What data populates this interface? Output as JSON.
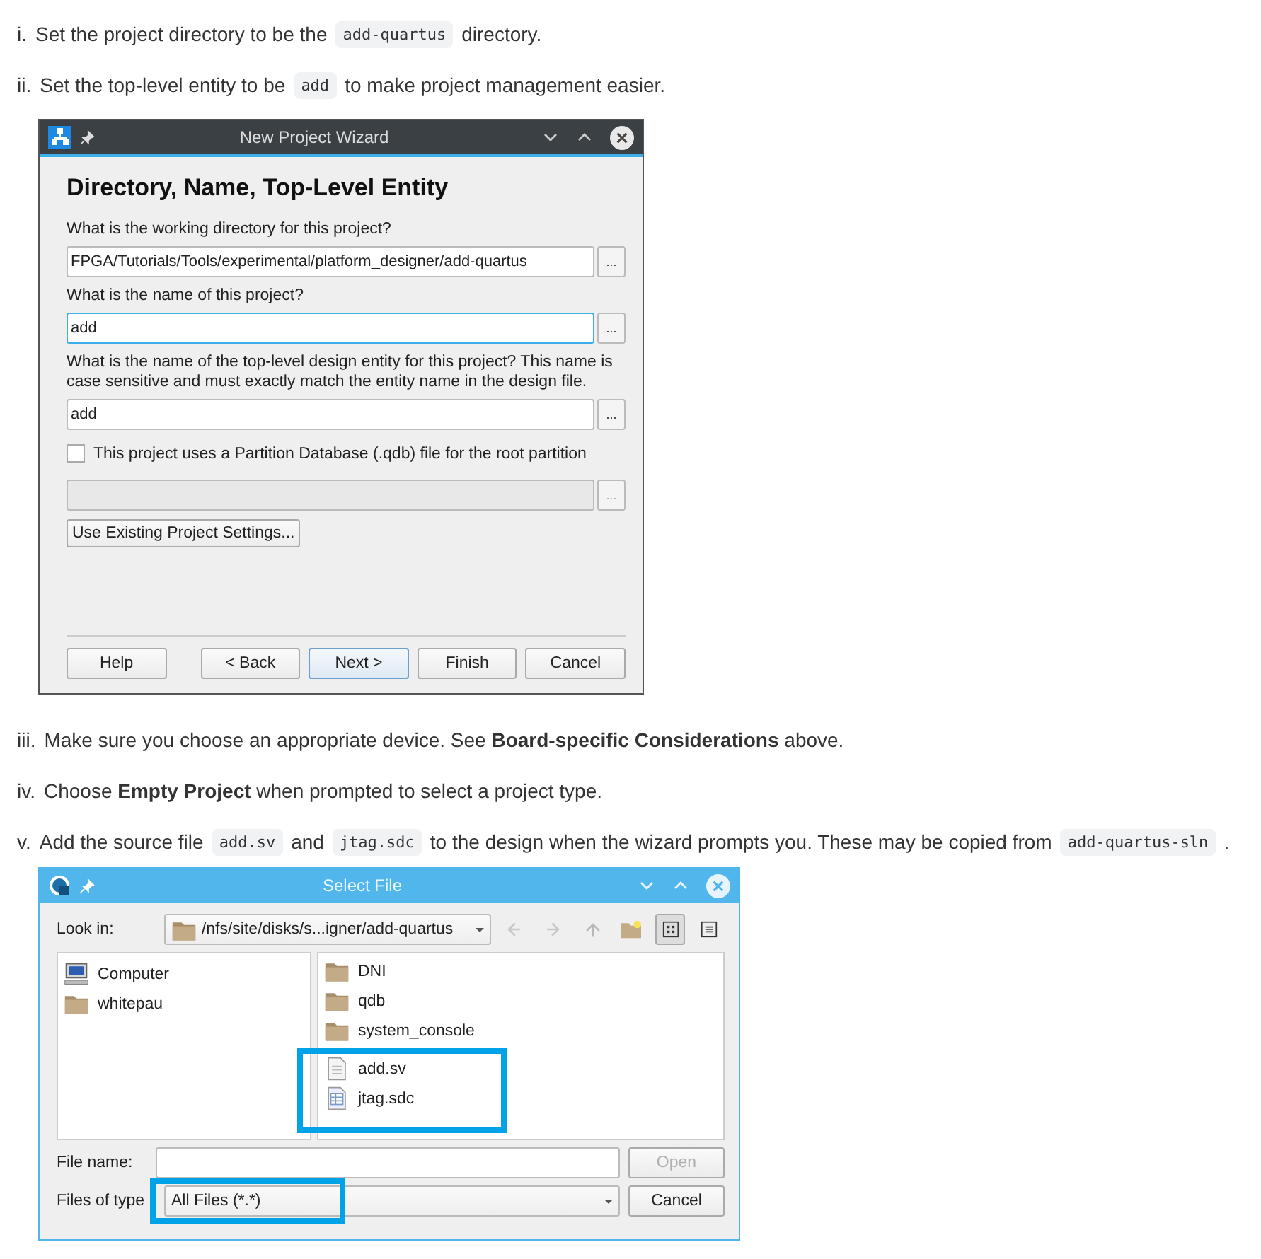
{
  "steps_top": [
    {
      "marker": "i.",
      "parts": [
        {
          "kind": "text",
          "text": "Set the project directory to be the"
        },
        {
          "kind": "code",
          "text": "add-quartus"
        },
        {
          "kind": "text",
          "text": "directory."
        }
      ]
    },
    {
      "marker": "ii.",
      "parts": [
        {
          "kind": "text",
          "text": "Set the top-level entity to be"
        },
        {
          "kind": "code",
          "text": "add"
        },
        {
          "kind": "text",
          "text": "to make project management easier."
        }
      ]
    }
  ],
  "wizard": {
    "title": "New Project Wizard",
    "heading": "Directory, Name, Top-Level Entity",
    "fields": [
      {
        "label": "What is the working directory for this project?",
        "value": "FPGA/Tutorials/Tools/experimental/platform_designer/add-quartus",
        "focused": false,
        "browse": "..."
      },
      {
        "label": "What is the name of this project?",
        "value": "add",
        "focused": true,
        "browse": "..."
      },
      {
        "label": "What is the name of the top-level design entity for this project? This name is case sensitive and must exactly match the entity name in the design file.",
        "value": "add",
        "focused": false,
        "browse": "..."
      }
    ],
    "checkbox": {
      "label": "This project uses a Partition Database (.qdb) file for the root partition",
      "checked": false
    },
    "qdb_field": {
      "disabled": true,
      "browse": "..."
    },
    "existing_button": "Use Existing Project Settings...",
    "buttons": [
      {
        "label": "Help",
        "default": false
      },
      {
        "label": "< Back",
        "default": false
      },
      {
        "label": "Next >",
        "default": true
      },
      {
        "label": "Finish",
        "default": false
      },
      {
        "label": "Cancel",
        "default": false
      }
    ]
  },
  "steps_bottom": [
    {
      "marker": "iii.",
      "parts": [
        {
          "kind": "text",
          "text": "Make sure you choose an appropriate device. See **Board-specific Considerations** above."
        }
      ]
    },
    {
      "marker": "iv.",
      "parts": [
        {
          "kind": "text",
          "text": "Choose **Empty Project** when prompted to select a project type."
        }
      ]
    },
    {
      "marker": "v.",
      "parts": [
        {
          "kind": "text",
          "text": "Add the source file"
        },
        {
          "kind": "code",
          "text": "add.sv"
        },
        {
          "kind": "text",
          "text": "and"
        },
        {
          "kind": "code",
          "text": "jtag.sdc"
        },
        {
          "kind": "text",
          "text": "to the design when the wizard prompts you. These may be copied from"
        },
        {
          "kind": "code",
          "text": "add-quartus-sln"
        },
        {
          "kind": "text",
          "text": "."
        }
      ]
    }
  ],
  "select_file": {
    "title": "Select File",
    "look_in_label": "Look in:",
    "look_in_value": "/nfs/site/disks/s...igner/add-quartus",
    "toolbar": [
      {
        "kind": "back",
        "selected": false
      },
      {
        "kind": "forward",
        "selected": false
      },
      {
        "kind": "up",
        "selected": false
      },
      {
        "kind": "new-folder",
        "selected": false
      },
      {
        "kind": "icon-view",
        "selected": true
      },
      {
        "kind": "detail-view",
        "selected": false
      }
    ],
    "places": [
      {
        "kind": "computer",
        "label": "Computer"
      },
      {
        "kind": "folder",
        "label": "whitepau"
      }
    ],
    "files": [
      {
        "kind": "folder",
        "name": "DNI",
        "highlighted": false
      },
      {
        "kind": "folder",
        "name": "qdb",
        "highlighted": false
      },
      {
        "kind": "folder",
        "name": "system_console",
        "highlighted": false
      },
      {
        "kind": "text-file",
        "name": "add.sv",
        "highlighted": true
      },
      {
        "kind": "table-file",
        "name": "jtag.sdc",
        "highlighted": true
      }
    ],
    "file_name_label": "File name:",
    "open_button": {
      "label": "Open",
      "disabled": true
    },
    "file_type_label": "Files of type",
    "file_type": {
      "value": "All Files (*.*)",
      "highlighted": true
    },
    "cancel_button": "Cancel"
  }
}
